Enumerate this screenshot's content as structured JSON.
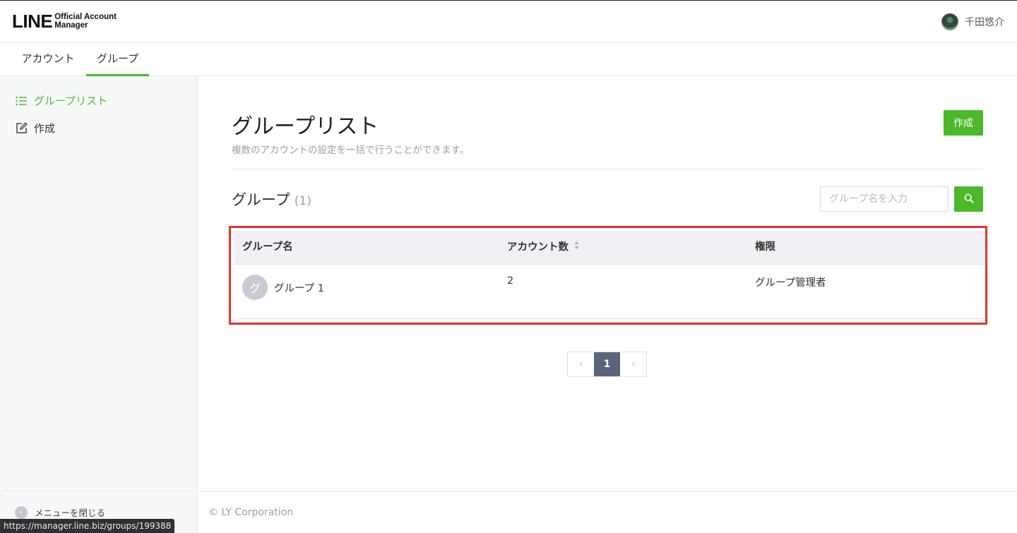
{
  "header": {
    "logo_main": "LINE",
    "logo_sub_line1": "Official Account",
    "logo_sub_line2": "Manager",
    "user_name": "千田悠介"
  },
  "tabs": [
    {
      "label": "アカウント",
      "active": false
    },
    {
      "label": "グループ",
      "active": true
    }
  ],
  "sidebar": {
    "items": [
      {
        "label": "グループリスト",
        "icon": "list-icon",
        "active": true
      },
      {
        "label": "作成",
        "icon": "edit-icon",
        "active": false
      }
    ],
    "close_label": "メニューを閉じる"
  },
  "main": {
    "title": "グループリスト",
    "description": "複数のアカウントの設定を一括で行うことができます。",
    "create_button": "作成",
    "section_title": "グループ",
    "section_count": "(1)",
    "search_placeholder": "グループ名を入力"
  },
  "table": {
    "headers": [
      "グループ名",
      "アカウント数",
      "権限"
    ],
    "rows": [
      {
        "avatar_letter": "グ",
        "name": "グループ 1",
        "count": "2",
        "role": "グループ管理者"
      }
    ]
  },
  "pagination": {
    "prev": "‹",
    "current": "1",
    "next": "›"
  },
  "footer": {
    "copyright": "© LY Corporation"
  },
  "status_url": "https://manager.line.biz/groups/199388",
  "colors": {
    "accent": "#4cb82a",
    "highlight_border": "#e8322b",
    "pager_current": "#5b6579"
  }
}
